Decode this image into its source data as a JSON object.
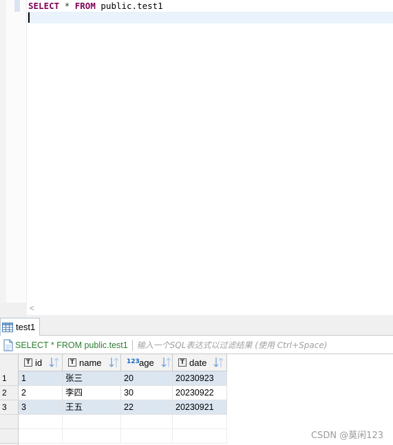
{
  "editor": {
    "sql": {
      "keyword_select": "SELECT",
      "star": "*",
      "keyword_from": "FROM",
      "table": "public.test1"
    },
    "scroll_left_arrow": "<"
  },
  "results": {
    "tab_label": "test1",
    "filter": {
      "query": "SELECT * FROM public.test1",
      "placeholder": "输入一个SQL表达式以过滤结果 (使用 Ctrl+Space)"
    },
    "columns": [
      {
        "name": "id",
        "type_icon": "T"
      },
      {
        "name": "name",
        "type_icon": "T"
      },
      {
        "name": "age",
        "type_icon": "123"
      },
      {
        "name": "date",
        "type_icon": "T"
      }
    ],
    "rows": [
      {
        "num": "1",
        "cells": [
          "1",
          "张三",
          "20",
          "20230923"
        ]
      },
      {
        "num": "2",
        "cells": [
          "2",
          "李四",
          "30",
          "20230922"
        ]
      },
      {
        "num": "3",
        "cells": [
          "3",
          "王五",
          "22",
          "20230921"
        ]
      }
    ]
  },
  "watermark": "CSDN @莫闲123"
}
